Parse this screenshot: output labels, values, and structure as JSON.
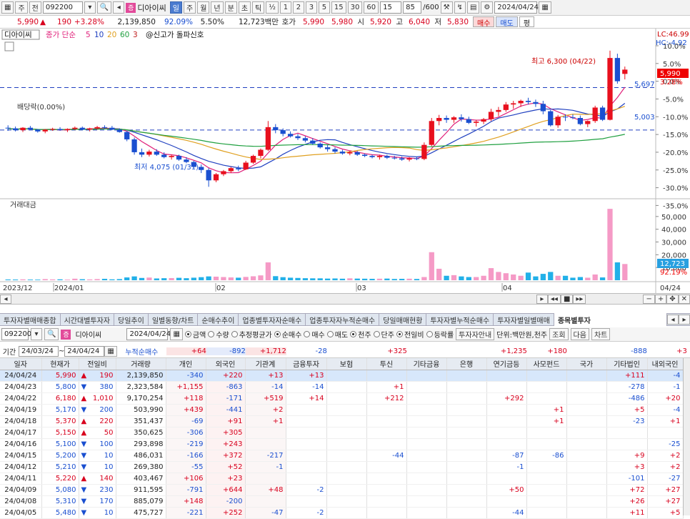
{
  "toolbar": {
    "type_label": "주",
    "scope_label": "전",
    "code": "092200",
    "name": "디아이씨",
    "badge": "증",
    "periods": [
      "일",
      "주",
      "월",
      "년",
      "분",
      "초",
      "틱"
    ],
    "ratio": "½",
    "minutes": [
      "1",
      "2",
      "3",
      "5",
      "15",
      "30",
      "60"
    ],
    "min_value": "15",
    "count": "85",
    "count_total": "/600",
    "date": "2024/04/24"
  },
  "quote": {
    "price": "5,990",
    "change": "190",
    "change_pct": "+3.28%",
    "volume": "2,139,850",
    "vol_ratio": "92.09%",
    "turnover": "5.50%",
    "amount": "12,723백만",
    "ask_label": "호가",
    "ask": "5,990",
    "bid": "5,980",
    "open_label": "시",
    "open": "5,920",
    "high_label": "고",
    "high": "6,040",
    "low_label": "저",
    "low": "5,830",
    "buy_label": "매수",
    "sell_label": "매도",
    "flat_label": "평"
  },
  "chart_legend": {
    "name": "디아이씨",
    "ma_label": "종가 단순",
    "ma": [
      "5",
      "10",
      "20",
      "60",
      "3"
    ],
    "signal": "@신고가 돌파신호",
    "lc": "LC:46.99",
    "hc": "HC:-4.92",
    "dividend": "배당락(0.00%)",
    "high_note": "최고 6,300 (04/22)",
    "low_note": "최저 4,075 (01/31)",
    "line1": "5,697",
    "line2": "5,003",
    "last_price": "5,990",
    "last_pct": "3.28%",
    "vol_label": "거래대금",
    "vol_last": "12,723",
    "vol_pct": "92.19%",
    "date_left": "2023/12",
    "date_2024": "2024/01",
    "month_02": "02",
    "month_03": "03",
    "month_04": "04",
    "date_right": "04/24"
  },
  "pct_axis": [
    "10.0%",
    "5.0%",
    "0.0%",
    "-5.0%",
    "-10.0%",
    "-15.0%",
    "-20.0%",
    "-25.0%",
    "-30.0%",
    "-35.0%"
  ],
  "vol_axis": [
    "50,000",
    "40,000",
    "30,000",
    "20,000",
    "10,000"
  ],
  "tabs": [
    "투자자별매매종합",
    "시간대별투자자",
    "당일추이",
    "일별동향/차트",
    "순매수추이",
    "업종별투자자순매수",
    "업종투자자누적순매수",
    "당일매매현황",
    "투자자별누적순매수",
    "투자자별일별매매",
    "종목별투자"
  ],
  "filter": {
    "code": "092200",
    "name": "디아이씨",
    "date": "2024/04/24",
    "opts1": [
      "금액",
      "수량",
      "추정평균가"
    ],
    "opts2": [
      "순매수",
      "매수",
      "매도"
    ],
    "opts3": [
      "천주",
      "단주"
    ],
    "opts4": [
      "전일비",
      "등락률"
    ],
    "guide": "투자자안내",
    "unit": "단위:백만원,천주",
    "query": "조회",
    "next": "다음",
    "chart": "차트"
  },
  "period": {
    "label": "기간",
    "from": "24/03/24",
    "to": "24/04/24",
    "cum_label": "누적순매수",
    "cum": [
      "+64",
      "-892",
      "+1,712",
      "-28",
      "",
      "+325",
      "",
      "",
      "+1,235",
      "+180",
      "",
      "-888",
      "+3"
    ]
  },
  "columns": [
    "일자",
    "현재가",
    "전일비",
    "거래량",
    "개인",
    "외국인",
    "기관계",
    "금융투자",
    "보험",
    "투신",
    "기타금융",
    "은행",
    "연기금등",
    "사모펀드",
    "국가",
    "기타법인",
    "내외국인"
  ],
  "rows": [
    [
      "24/04/24",
      "5,990",
      "▲",
      "190",
      "2,139,850",
      "-340",
      "+220",
      "+13",
      "+13",
      "",
      "",
      "",
      "",
      "",
      "",
      "",
      "+111",
      "-4"
    ],
    [
      "24/04/23",
      "5,800",
      "▼",
      "380",
      "2,323,584",
      "+1,155",
      "-863",
      "-14",
      "-14",
      "",
      "+1",
      "",
      "",
      "",
      "",
      "",
      "-278",
      "-1"
    ],
    [
      "24/04/22",
      "6,180",
      "▲",
      "1,010",
      "9,170,254",
      "+118",
      "-171",
      "+519",
      "+14",
      "",
      "+212",
      "",
      "",
      "+292",
      "",
      "",
      "-486",
      "+20"
    ],
    [
      "24/04/19",
      "5,170",
      "▼",
      "200",
      "503,990",
      "+439",
      "-441",
      "+2",
      "",
      "",
      "",
      "",
      "",
      "",
      "+1",
      "",
      "+5",
      "-4"
    ],
    [
      "24/04/18",
      "5,370",
      "▲",
      "220",
      "351,437",
      "-69",
      "+91",
      "+1",
      "",
      "",
      "",
      "",
      "",
      "",
      "+1",
      "",
      "-23",
      "+1"
    ],
    [
      "24/04/17",
      "5,150",
      "▲",
      "50",
      "350,625",
      "-306",
      "+305",
      "",
      "",
      "",
      "",
      "",
      "",
      "",
      "",
      "",
      "",
      ""
    ],
    [
      "24/04/16",
      "5,100",
      "▼",
      "100",
      "293,898",
      "-219",
      "+243",
      "",
      "",
      "",
      "",
      "",
      "",
      "",
      "",
      "",
      "",
      "-25"
    ],
    [
      "24/04/15",
      "5,200",
      "▼",
      "10",
      "486,031",
      "-166",
      "+372",
      "-217",
      "",
      "",
      "-44",
      "",
      "",
      "-87",
      "-86",
      "",
      "+9",
      "+2"
    ],
    [
      "24/04/12",
      "5,210",
      "▼",
      "10",
      "269,380",
      "-55",
      "+52",
      "-1",
      "",
      "",
      "",
      "",
      "",
      "-1",
      "",
      "",
      "+3",
      "+2"
    ],
    [
      "24/04/11",
      "5,220",
      "▲",
      "140",
      "403,467",
      "+106",
      "+23",
      "",
      "",
      "",
      "",
      "",
      "",
      "",
      "",
      "",
      "-101",
      "-27"
    ],
    [
      "24/04/09",
      "5,080",
      "▼",
      "230",
      "911,595",
      "-791",
      "+644",
      "+48",
      "-2",
      "",
      "",
      "",
      "",
      "+50",
      "",
      "",
      "+72",
      "+27"
    ],
    [
      "24/04/08",
      "5,310",
      "▼",
      "170",
      "885,079",
      "+148",
      "-200",
      "",
      "",
      "",
      "",
      "",
      "",
      "",
      "",
      "",
      "+26",
      "+27"
    ],
    [
      "24/04/05",
      "5,480",
      "▼",
      "10",
      "475,727",
      "-221",
      "+252",
      "-47",
      "-2",
      "",
      "",
      "",
      "",
      "-44",
      "",
      "",
      "+11",
      "+5"
    ]
  ],
  "chart_data": {
    "type": "candlestick",
    "candles": [
      [
        5040,
        5080,
        4990,
        5030
      ],
      [
        5030,
        5060,
        4980,
        5000
      ],
      [
        5000,
        5050,
        4970,
        5040
      ],
      [
        5040,
        5070,
        5000,
        5010
      ],
      [
        5010,
        5020,
        4960,
        4980
      ],
      [
        4980,
        5020,
        4950,
        5010
      ],
      [
        5010,
        5040,
        4990,
        5020
      ],
      [
        5020,
        5050,
        4990,
        5000
      ],
      [
        5000,
        5030,
        4970,
        5020
      ],
      [
        5020,
        5060,
        5000,
        5040
      ],
      [
        5040,
        5060,
        5000,
        5010
      ],
      [
        5010,
        5040,
        4980,
        5030
      ],
      [
        5030,
        5070,
        5010,
        5050
      ],
      [
        5050,
        5080,
        5020,
        5040
      ],
      [
        5040,
        5070,
        5000,
        5010
      ],
      [
        5010,
        5030,
        4960,
        4970
      ],
      [
        4970,
        4990,
        4820,
        4850
      ],
      [
        4850,
        4880,
        4600,
        4640
      ],
      [
        4640,
        4700,
        4560,
        4600
      ],
      [
        4600,
        4680,
        4570,
        4650
      ],
      [
        4650,
        4690,
        4580,
        4600
      ],
      [
        4600,
        4640,
        4540,
        4560
      ],
      [
        4560,
        4600,
        4520,
        4580
      ],
      [
        4580,
        4600,
        4500,
        4520
      ],
      [
        4520,
        4560,
        4460,
        4480
      ],
      [
        4480,
        4500,
        4380,
        4400
      ],
      [
        4400,
        4440,
        4300,
        4350
      ],
      [
        4350,
        4380,
        4075,
        4180
      ],
      [
        4180,
        4300,
        4150,
        4280
      ],
      [
        4280,
        4350,
        4250,
        4330
      ],
      [
        4330,
        4400,
        4300,
        4380
      ],
      [
        4380,
        4420,
        4330,
        4360
      ],
      [
        4360,
        4500,
        4350,
        4470
      ],
      [
        4470,
        4600,
        4450,
        4580
      ],
      [
        4580,
        4700,
        4540,
        4680
      ],
      [
        4680,
        5150,
        4660,
        5050
      ],
      [
        5050,
        5100,
        4950,
        5000
      ],
      [
        5000,
        5030,
        4900,
        4940
      ],
      [
        4940,
        4980,
        4880,
        4900
      ],
      [
        4900,
        4940,
        4840,
        4870
      ],
      [
        4870,
        4900,
        4800,
        4830
      ],
      [
        4830,
        4870,
        4760,
        4780
      ],
      [
        4780,
        4800,
        4700,
        4720
      ],
      [
        4720,
        4760,
        4650,
        4690
      ],
      [
        4690,
        4720,
        4620,
        4650
      ],
      [
        4650,
        4680,
        4600,
        4620
      ],
      [
        4620,
        4660,
        4590,
        4640
      ],
      [
        4640,
        4660,
        4580,
        4600
      ],
      [
        4600,
        4620,
        4560,
        4580
      ],
      [
        4580,
        4600,
        4540,
        4560
      ],
      [
        4560,
        4600,
        4520,
        4580
      ],
      [
        4580,
        4600,
        4530,
        4550
      ],
      [
        4550,
        4580,
        4520,
        4540
      ],
      [
        4540,
        4570,
        4500,
        4520
      ],
      [
        4520,
        4560,
        4490,
        4540
      ],
      [
        4540,
        4570,
        4510,
        4530
      ],
      [
        4530,
        4800,
        4510,
        4760
      ],
      [
        4760,
        5200,
        4740,
        5150
      ],
      [
        5150,
        5250,
        5080,
        5200
      ],
      [
        5200,
        5240,
        5120,
        5170
      ],
      [
        5170,
        5230,
        5120,
        5210
      ],
      [
        5210,
        5260,
        5140,
        5180
      ],
      [
        5180,
        5220,
        5100,
        5120
      ],
      [
        5120,
        5170,
        5060,
        5140
      ],
      [
        5140,
        5200,
        5100,
        5180
      ],
      [
        5180,
        5350,
        5150,
        5300
      ],
      [
        5300,
        5380,
        5230,
        5330
      ],
      [
        5330,
        5460,
        5300,
        5420
      ],
      [
        5420,
        5480,
        5350,
        5440
      ],
      [
        5440,
        5500,
        5380,
        5480
      ],
      [
        5480,
        5530,
        5420,
        5460
      ],
      [
        5460,
        5500,
        5380,
        5430
      ],
      [
        5430,
        5480,
        5260,
        5310
      ],
      [
        5310,
        5330,
        5060,
        5080
      ],
      [
        5080,
        5250,
        5040,
        5220
      ],
      [
        5220,
        5260,
        5150,
        5210
      ],
      [
        5210,
        5260,
        5180,
        5200
      ],
      [
        5200,
        5240,
        5080,
        5100
      ],
      [
        5100,
        5160,
        5050,
        5150
      ],
      [
        5150,
        5400,
        5120,
        5370
      ],
      [
        5370,
        5400,
        5150,
        5170
      ],
      [
        5170,
        6300,
        5160,
        6180
      ],
      [
        6180,
        6250,
        5760,
        5800
      ],
      [
        5920,
        6040,
        5830,
        5990
      ]
    ],
    "volume": [
      600,
      550,
      700,
      500,
      480,
      900,
      650,
      700,
      500,
      1200,
      800,
      650,
      900,
      1100,
      700,
      900,
      2200,
      3000,
      1800,
      2100,
      1400,
      1600,
      1700,
      1900,
      1600,
      2000,
      2400,
      3000,
      2800,
      2500,
      2200,
      2000,
      2600,
      3100,
      3800,
      14000,
      3200,
      2400,
      2000,
      1800,
      1600,
      1500,
      1500,
      1300,
      1400,
      1200,
      1500,
      1300,
      1200,
      1100,
      1200,
      1300,
      1000,
      1100,
      1200,
      1000,
      2500,
      22000,
      9000,
      3500,
      4000,
      3000,
      2500,
      2500,
      3500,
      9500,
      6500,
      5500,
      4500,
      3500,
      6000,
      3000,
      5000,
      6500,
      3500,
      3500,
      2000,
      2500,
      2000,
      4500,
      2200,
      56000,
      14000,
      12723
    ],
    "ma5_start": 4700,
    "high": 6300,
    "low": 4075
  }
}
